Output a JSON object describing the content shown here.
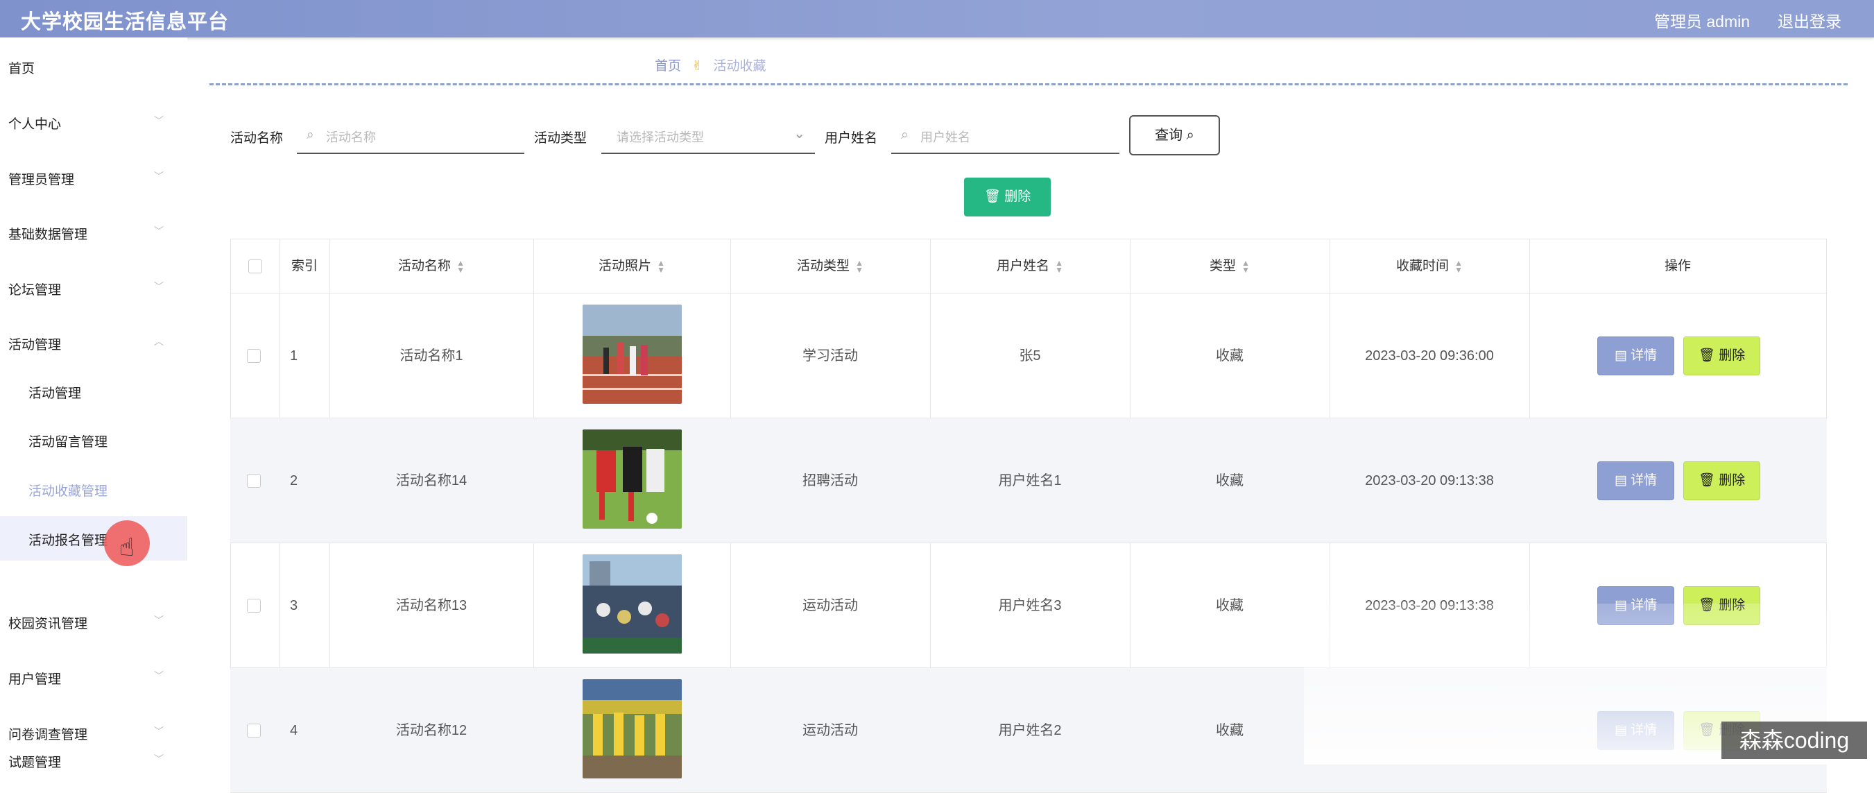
{
  "header": {
    "title": "大学校园生活信息平台",
    "user": "管理员 admin",
    "logout": "退出登录"
  },
  "sidebar": {
    "items": [
      {
        "label": "首页"
      },
      {
        "label": "个人中心"
      },
      {
        "label": "管理员管理"
      },
      {
        "label": "基础数据管理"
      },
      {
        "label": "论坛管理"
      },
      {
        "label": "活动管理"
      },
      {
        "label": "校园资讯管理"
      },
      {
        "label": "用户管理"
      },
      {
        "label": "问卷调查管理"
      },
      {
        "label": "试题管理"
      }
    ],
    "sub_items": [
      {
        "label": "活动管理"
      },
      {
        "label": "活动留言管理"
      },
      {
        "label": "活动收藏管理"
      },
      {
        "label": "活动报名管理"
      }
    ]
  },
  "breadcrumb": {
    "home": "首页",
    "current": "活动收藏"
  },
  "search": {
    "name_label": "活动名称",
    "name_placeholder": "活动名称",
    "type_label": "活动类型",
    "type_placeholder": "请选择活动类型",
    "user_label": "用户姓名",
    "user_placeholder": "用户姓名",
    "query_button": "查询",
    "delete_button": "删除"
  },
  "table": {
    "columns": [
      "索引",
      "活动名称",
      "活动照片",
      "活动类型",
      "用户姓名",
      "类型",
      "收藏时间",
      "操作"
    ],
    "rows": [
      {
        "index": "1",
        "name": "活动名称1",
        "type": "学习活动",
        "user": "张5",
        "kind": "收藏",
        "time": "2023-03-20 09:36:00"
      },
      {
        "index": "2",
        "name": "活动名称14",
        "type": "招聘活动",
        "user": "用户姓名1",
        "kind": "收藏",
        "time": "2023-03-20 09:13:38"
      },
      {
        "index": "3",
        "name": "活动名称13",
        "type": "运动活动",
        "user": "用户姓名3",
        "kind": "收藏",
        "time": "2023-03-20 09:13:38"
      },
      {
        "index": "4",
        "name": "活动名称12",
        "type": "运动活动",
        "user": "用户姓名2",
        "kind": "收藏",
        "time": ""
      }
    ],
    "detail_label": "详情",
    "delete_label": "删除"
  },
  "watermark": "森森coding"
}
